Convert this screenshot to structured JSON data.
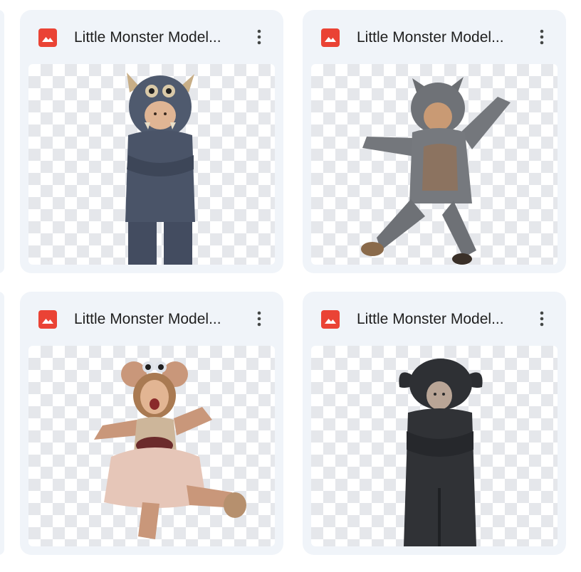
{
  "files": [
    {
      "name": "Little Monster Model...",
      "icon": "image-file-icon",
      "thumbnail": "blue-furry-monster-costume-child-arms-crossed"
    },
    {
      "name": "Little Monster Model...",
      "icon": "image-file-icon",
      "thumbnail": "grey-furry-monster-costume-child-jumping"
    },
    {
      "name": "Little Monster Model...",
      "icon": "image-file-icon",
      "thumbnail": "girl-in-tan-monster-tutu-costume-dancing"
    },
    {
      "name": "Little Monster Model...",
      "icon": "image-file-icon",
      "thumbnail": "black-furry-monster-costume-child-standing"
    }
  ],
  "colors": {
    "card_bg": "#f0f4f9",
    "icon_red": "#ea4335",
    "text": "#1f1f1f"
  }
}
